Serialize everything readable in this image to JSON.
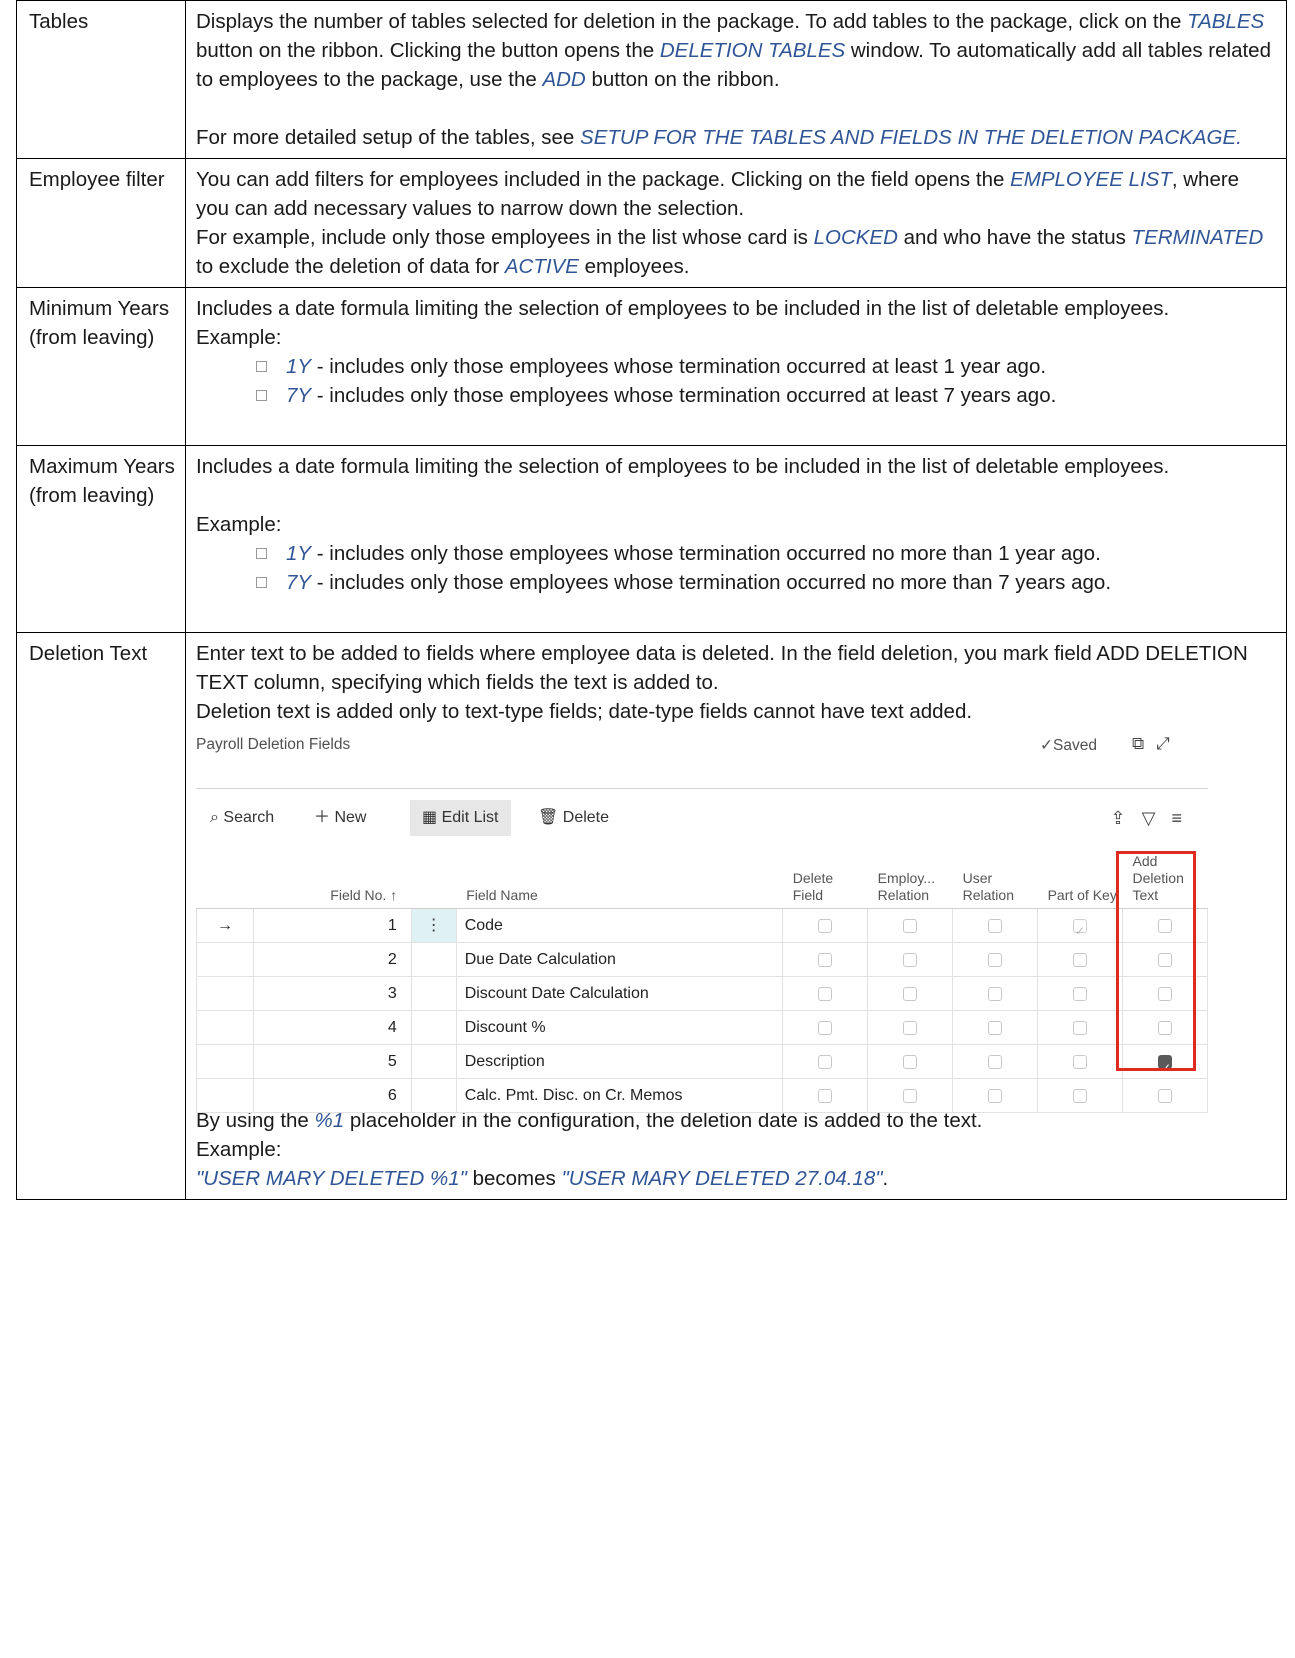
{
  "rows": [
    {
      "label": "Tables",
      "text": [
        [
          {
            "t": "Displays the number of tables selected for deletion in the package. To add tables to the package, click on the "
          },
          {
            "t": "TABLES",
            "em": true
          },
          {
            "t": " button on the ribbon. Clicking the button opens the "
          },
          {
            "t": "DELETION TABLES",
            "em": true
          },
          {
            "t": " window. To automatically add all tables related to employees to the package, use the "
          },
          {
            "t": "ADD",
            "em": true
          },
          {
            "t": " button on the ribbon."
          }
        ],
        [],
        [
          {
            "t": "For more detailed setup of the tables, see "
          },
          {
            "t": "SETUP FOR THE TABLES AND FIELDS IN THE DELETION PACKAGE.",
            "em": true
          }
        ]
      ]
    },
    {
      "label": "Employee filter",
      "text": [
        [
          {
            "t": "You can add filters for employees included in the package. Clicking on the field opens the "
          },
          {
            "t": "EMPLOYEE LIST",
            "em": true
          },
          {
            "t": ", where you can add necessary values to narrow down the selection."
          }
        ],
        [
          {
            "t": "For example, include only those employees in the list whose card is "
          },
          {
            "t": "LOCKED",
            "em": true
          },
          {
            "t": " and who have the status "
          },
          {
            "t": "TERMINATED",
            "em": true
          },
          {
            "t": " to exclude the deletion of data for "
          },
          {
            "t": "ACTIVE",
            "em": true
          },
          {
            "t": " employees."
          }
        ]
      ]
    },
    {
      "label": "Minimum Years (from leaving)",
      "text": [
        [
          {
            "t": "Includes a date formula limiting the selection of employees to be included in the list of deletable employees."
          }
        ],
        [
          {
            "t": "Example:"
          }
        ]
      ],
      "bullets": [
        [
          {
            "t": "1Y",
            "em": true
          },
          {
            "t": " - includes only those employees whose termination occurred at least 1 year ago."
          }
        ],
        [
          {
            "t": "7Y",
            "em": true
          },
          {
            "t": " - includes only those employees whose termination occurred at least 7 years ago."
          }
        ]
      ]
    },
    {
      "label": "Maximum Years (from leaving)",
      "text": [
        [
          {
            "t": "Includes a date formula limiting the selection of employees to be included in the list of deletable employees."
          }
        ],
        [],
        [
          {
            "t": "Example:"
          }
        ]
      ],
      "bullets": [
        [
          {
            "t": "1Y",
            "em": true
          },
          {
            "t": " - includes only those employees whose termination occurred no more than 1 year ago."
          }
        ],
        [
          {
            "t": "7Y",
            "em": true
          },
          {
            "t": " - includes only those employees whose termination occurred no more than 7 years ago."
          }
        ]
      ]
    },
    {
      "label": "Deletion Text",
      "text": [
        [
          {
            "t": "Enter text to be added to fields where employee data is deleted. In the field deletion, you mark field ADD DELETION TEXT column, specifying which fields the text is added to."
          }
        ],
        [
          {
            "t": "Deletion text is added only to text-type fields; date-type fields cannot have text added."
          }
        ]
      ],
      "after": [
        [
          {
            "t": "By using the "
          },
          {
            "t": "%1",
            "em": true
          },
          {
            "t": " placeholder in the configuration, the deletion date is added to the text."
          }
        ],
        [
          {
            "t": "Example:"
          }
        ],
        [
          {
            "t": "\"USER MARY DELETED %1\"",
            "em": true
          },
          {
            "t": " becomes "
          },
          {
            "t": "\"USER MARY DELETED 27.04.18\"",
            "em": true
          },
          {
            "t": "."
          }
        ]
      ]
    }
  ],
  "screenshot": {
    "title": "Payroll Deletion Fields",
    "saved": "Saved",
    "toolbar": {
      "search": "Search",
      "new": "New",
      "edit_list": "Edit List",
      "delete": "Delete"
    },
    "columns": {
      "field_no": "Field No. ↑",
      "field_name": "Field Name",
      "delete_field": "Delete Field",
      "employ_relation": "Employ... Relation",
      "user_relation": "User Relation",
      "part_of_key": "Part of Key",
      "add_deletion_text": "Add Deletion Text"
    },
    "rows": [
      {
        "no": "1",
        "name": "Code",
        "delete": false,
        "employ": false,
        "user": false,
        "key": true,
        "add": false,
        "current": true
      },
      {
        "no": "2",
        "name": "Due Date Calculation",
        "delete": false,
        "employ": false,
        "user": false,
        "key": false,
        "add": false
      },
      {
        "no": "3",
        "name": "Discount Date Calculation",
        "delete": false,
        "employ": false,
        "user": false,
        "key": false,
        "add": false
      },
      {
        "no": "4",
        "name": "Discount %",
        "delete": false,
        "employ": false,
        "user": false,
        "key": false,
        "add": false
      },
      {
        "no": "5",
        "name": "Description",
        "delete": false,
        "employ": false,
        "user": false,
        "key": false,
        "add": true
      },
      {
        "no": "6",
        "name": "Calc. Pmt. Disc. on Cr. Memos",
        "delete": false,
        "employ": false,
        "user": false,
        "key": false,
        "add": false
      }
    ]
  },
  "icons": {
    "search": "search-icon",
    "new": "plus-icon",
    "edit_list": "edit-list-icon",
    "delete": "trash-icon",
    "share": "share-icon",
    "filter": "filter-icon",
    "list": "list-view-icon",
    "open_new": "open-in-new-window-icon",
    "expand": "expand-icon",
    "check": "check-icon",
    "arrow": "current-row-arrow-icon"
  },
  "colors": {
    "emphasis": "#2f5597",
    "highlight_border": "#e0291f"
  }
}
